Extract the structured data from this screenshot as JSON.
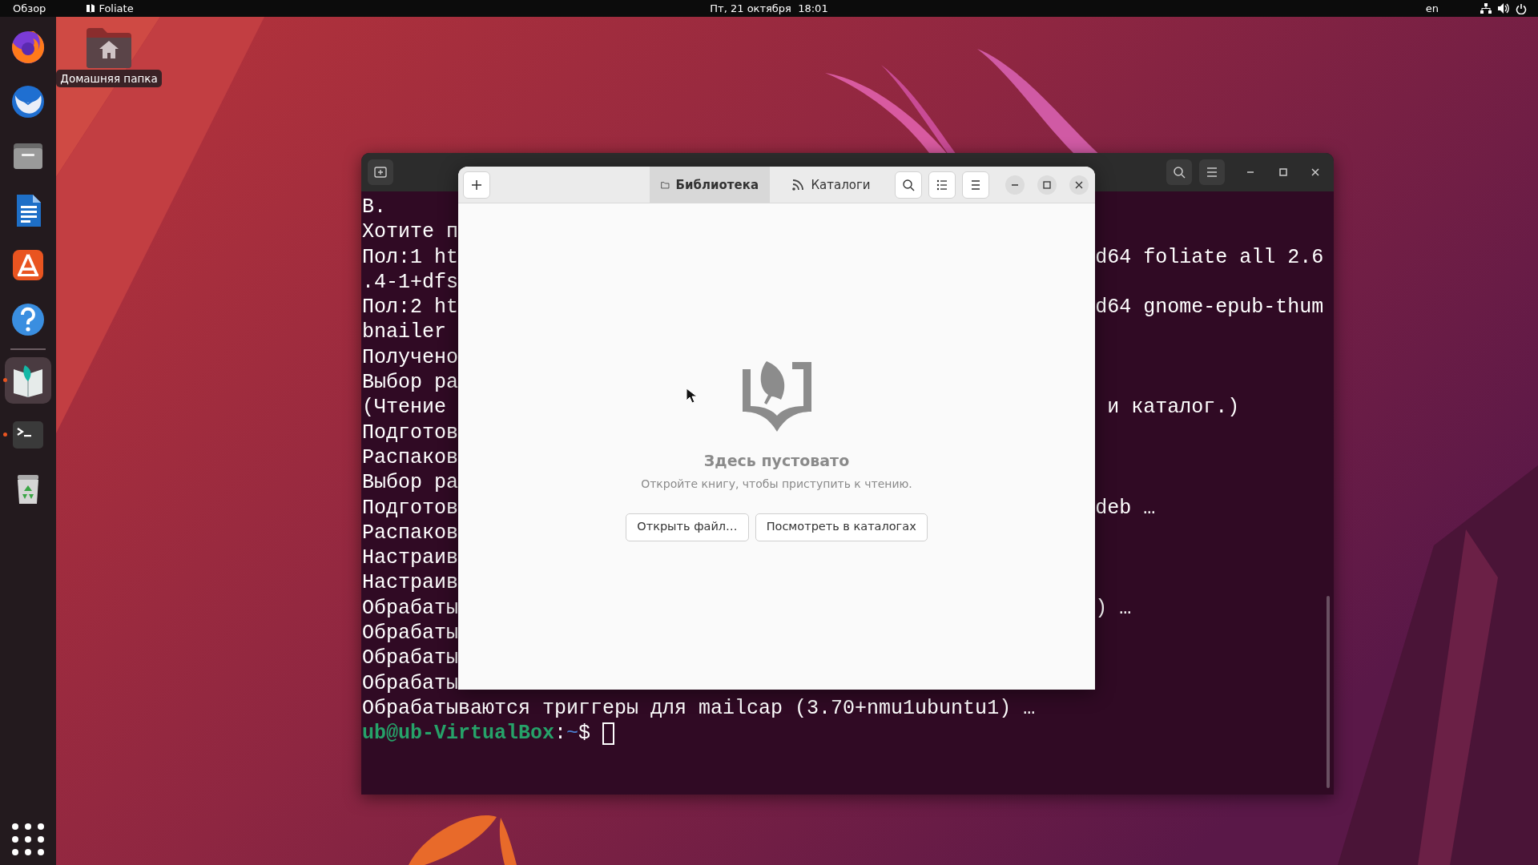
{
  "top_bar": {
    "activities": "Обзор",
    "app": {
      "name": "Foliate"
    },
    "clock": "Пт, 21 октября  18:01",
    "keyboard_layout": "en"
  },
  "dock": {
    "apps": [
      {
        "kind": "browser",
        "running": false,
        "selected": false
      },
      {
        "kind": "mail",
        "running": false,
        "selected": false
      },
      {
        "kind": "files",
        "running": false,
        "selected": false
      },
      {
        "kind": "writer",
        "running": false,
        "selected": false
      },
      {
        "kind": "store",
        "running": false,
        "selected": false
      },
      {
        "kind": "help",
        "running": false,
        "selected": false
      },
      {
        "kind": "separator"
      },
      {
        "kind": "reader",
        "running": true,
        "selected": true
      },
      {
        "kind": "terminal",
        "running": true,
        "selected": false
      },
      {
        "kind": "trash",
        "running": false,
        "selected": false
      }
    ]
  },
  "desktop_icons": [
    {
      "label": "Домашняя папка"
    }
  ],
  "terminal": {
    "lines": [
      {
        "left": "В."
      },
      {
        "left": "Хотите п"
      },
      {
        "left": "Пол:1 ht",
        "right": "d64 foliate all 2.6"
      },
      {
        "left": ".4-1+dfs"
      },
      {
        "left": "Пол:2 ht",
        "right": "d64 gnome-epub-thum"
      },
      {
        "left": "bnailer"
      },
      {
        "left": "Получено"
      },
      {
        "left": "Выбор ра"
      },
      {
        "left": "(Чтение",
        "right": " и каталог.)"
      },
      {
        "left": "Подготов"
      },
      {
        "left": "Распаков"
      },
      {
        "left": "Выбор ра"
      },
      {
        "left": "Подготов",
        "right": "deb …"
      },
      {
        "left": "Распаков"
      },
      {
        "left": "Настраив"
      },
      {
        "left": "Настраив"
      },
      {
        "left": "Обрабаты",
        "right": ") …"
      },
      {
        "left": "Обрабаты"
      },
      {
        "left": "Обрабаты"
      },
      {
        "left": "Обрабаты"
      },
      {
        "text": "Обрабатываются триггеры для mailcap (3.70+nmu1ubuntu1) …"
      }
    ],
    "prompt": {
      "user_host": "ub@ub-VirtualBox",
      "separator": ":",
      "path": "~",
      "symbol": "$"
    }
  },
  "foliate": {
    "tabs": [
      {
        "kind": "library",
        "label": "Библиотека",
        "selected": true
      },
      {
        "kind": "catalogs",
        "label": "Каталоги",
        "selected": false
      }
    ],
    "empty_state": {
      "title": "Здесь пустовато",
      "message": "Откройте книгу, чтобы приступить к чтению."
    },
    "buttons": [
      "Открыть файл…",
      "Посмотреть в каталогах"
    ]
  }
}
